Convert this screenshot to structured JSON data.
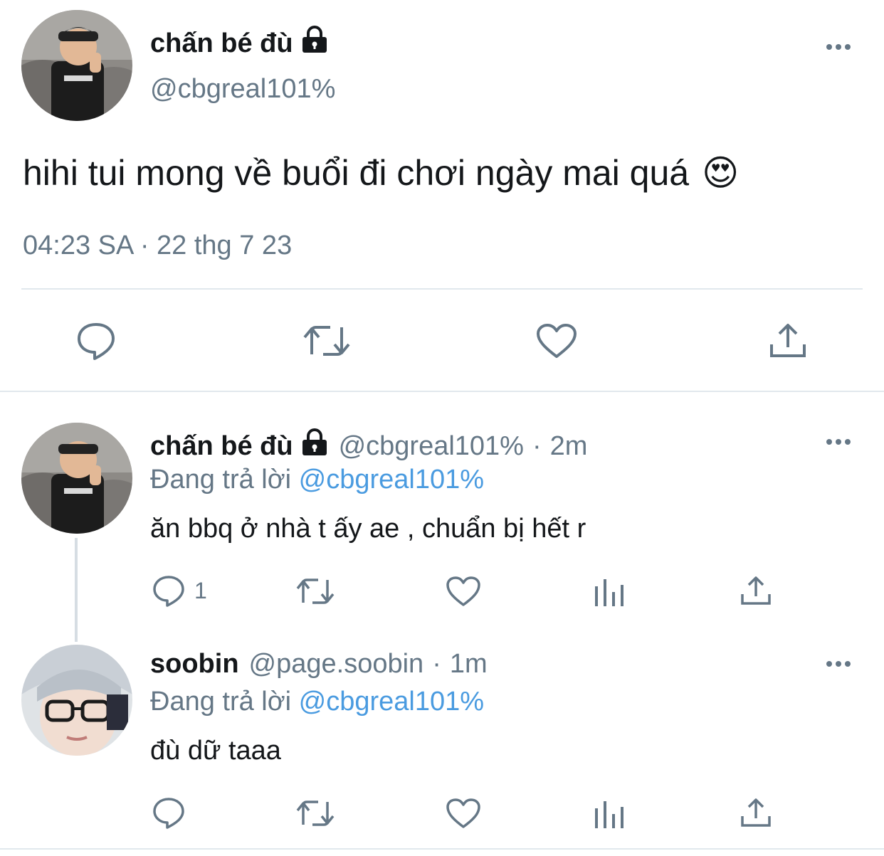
{
  "main_tweet": {
    "author_name": "chấn bé đù",
    "handle": "@cbgreal101%",
    "text": "hihi tui mong về buổi đi chơi ngày mai quá",
    "emoji": "😍",
    "time": "04:23 SA",
    "separator": "·",
    "date": "22 thg 7 23",
    "icons": [
      "reply-icon",
      "retweet-icon",
      "like-icon",
      "share-icon"
    ]
  },
  "replies": [
    {
      "author_name": "chấn bé đù",
      "handle": "@cbgreal101%",
      "separator": "·",
      "age": "2m",
      "replying_prefix": "Đang trả lời",
      "replying_to": "@cbgreal101%",
      "text": "ăn bbq ở nhà t ấy ae , chuẩn bị hết r",
      "reply_count": "1",
      "locked": true
    },
    {
      "author_name": "soobin",
      "handle": "@page.soobin",
      "separator": "·",
      "age": "1m",
      "replying_prefix": "Đang trả lời",
      "replying_to": "@cbgreal101%",
      "text": "đù dữ taaa",
      "reply_count": "",
      "locked": false
    }
  ],
  "colors": {
    "text": "#14171a",
    "muted": "#657786",
    "link": "#4a9be0",
    "divider": "#e1e8ed"
  }
}
